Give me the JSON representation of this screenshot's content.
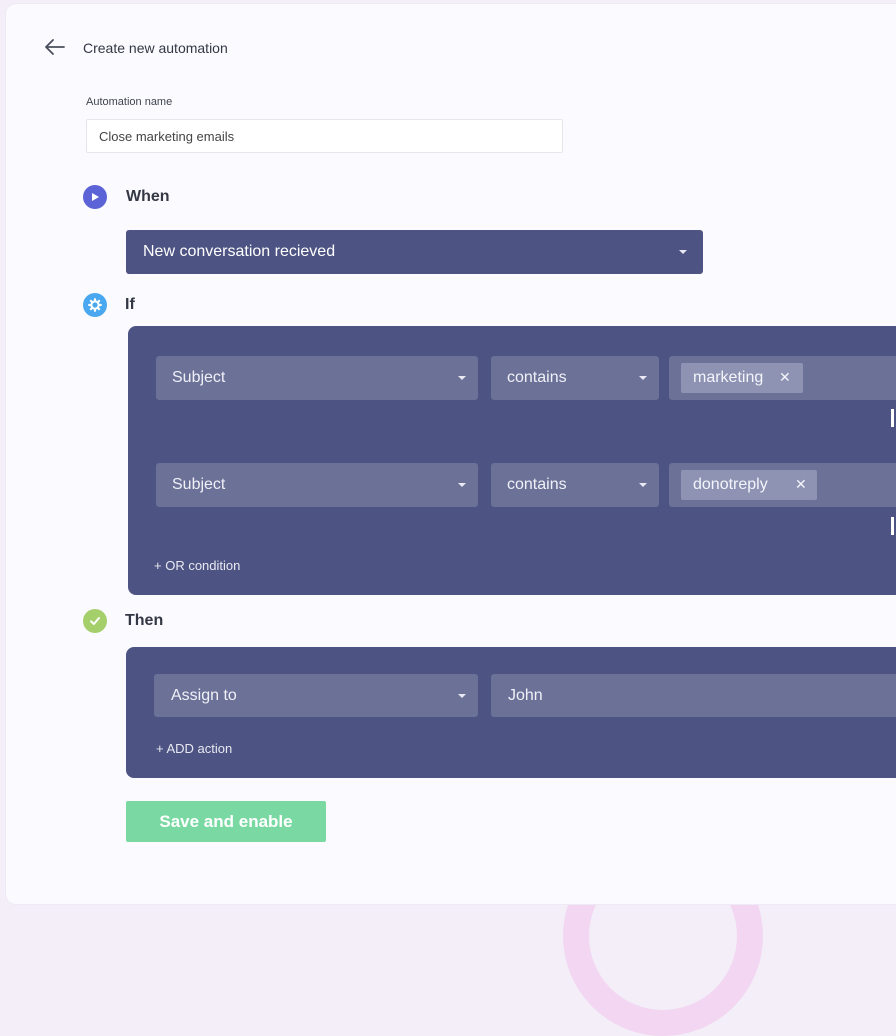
{
  "header": {
    "title": "Create new automation",
    "back_icon": "arrow-left-icon"
  },
  "automation_name": {
    "label": "Automation name",
    "value": "Close marketing emails"
  },
  "when": {
    "label": "When",
    "icon": "play-icon",
    "icon_color": "#5b63d6",
    "trigger": "New conversation recieved"
  },
  "if": {
    "label": "If",
    "icon": "gear-icon",
    "icon_color": "#4aa8f0",
    "conditions": [
      {
        "field": "Subject",
        "operator": "contains",
        "tag": "marketing"
      },
      {
        "field": "Subject",
        "operator": "contains",
        "tag": "donotreply"
      }
    ],
    "or_condition_label": "+ OR condition"
  },
  "then": {
    "label": "Then",
    "icon": "check-icon",
    "icon_color": "#a5cf6a",
    "action": "Assign to",
    "assignee": "John",
    "add_action_label": "+ ADD action"
  },
  "save_label": "Save and enable",
  "colors": {
    "panel": "#4d5382",
    "accent_green": "#7ad9a3"
  }
}
